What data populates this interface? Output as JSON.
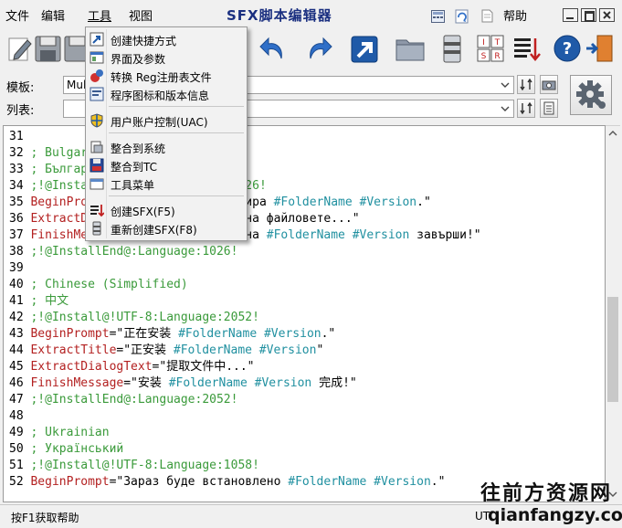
{
  "menubar": {
    "file": "文件",
    "edit": "编辑",
    "tools": "工具",
    "view": "视图",
    "title": "SFX脚本编辑器",
    "help": "帮助"
  },
  "form": {
    "template_label": "模板:",
    "template_value": "Mul",
    "list_label": "列表:",
    "list_value": ""
  },
  "tools_menu": {
    "items": [
      {
        "label": "创建快捷方式",
        "icon": "shortcut-icon"
      },
      {
        "label": "界面及参数",
        "icon": "interface-icon"
      },
      {
        "label": "转换 Reg注册表文件",
        "icon": "registry-icon"
      },
      {
        "label": "程序图标和版本信息",
        "icon": "program-info-icon"
      },
      {
        "label": "用户账户控制(UAC)",
        "icon": "uac-shield-icon"
      },
      {
        "label": "整合到系统",
        "icon": "system-integrate-icon"
      },
      {
        "label": "整合到TC",
        "icon": "tc-disk-icon"
      },
      {
        "label": "工具菜单",
        "icon": "tool-menu-icon"
      },
      {
        "label": "创建SFX(F5)",
        "icon": "create-sfx-icon"
      },
      {
        "label": "重新创建SFX(F8)",
        "icon": "recreate-sfx-icon"
      }
    ]
  },
  "editor": {
    "lines": [
      {
        "n": "31",
        "parts": []
      },
      {
        "n": "32",
        "parts": [
          {
            "t": "; Bulgar",
            "c": "green"
          }
        ]
      },
      {
        "n": "33",
        "parts": [
          {
            "t": "; Българ",
            "c": "green"
          }
        ]
      },
      {
        "n": "34",
        "parts": [
          {
            "t": ";!@Instal",
            "c": "green"
          },
          {
            "t": "                     26!",
            "c": "green"
          }
        ]
      },
      {
        "n": "35",
        "parts": [
          {
            "t": "BeginPrompt",
            "c": "red"
          },
          {
            "t": "                   ира ",
            "c": "black"
          },
          {
            "t": "#FolderName #Version",
            "c": "teal"
          },
          {
            "t": ".\"",
            "c": "black"
          }
        ]
      },
      {
        "n": "36",
        "parts": [
          {
            "t": "ExtractDi",
            "c": "red"
          },
          {
            "t": "                     на файловете...\"",
            "c": "black"
          }
        ]
      },
      {
        "n": "37",
        "parts": [
          {
            "t": "FinishMe",
            "c": "red"
          },
          {
            "t": "                      на ",
            "c": "black"
          },
          {
            "t": "#FolderName #Version",
            "c": "teal"
          },
          {
            "t": " завърши!\"",
            "c": "black"
          }
        ]
      },
      {
        "n": "38",
        "parts": [
          {
            "t": ";!@InstallEnd@:Language:1026!",
            "c": "green"
          }
        ]
      },
      {
        "n": "39",
        "parts": []
      },
      {
        "n": "40",
        "parts": [
          {
            "t": "; Chinese (Simplified)",
            "c": "green"
          }
        ]
      },
      {
        "n": "41",
        "parts": [
          {
            "t": "; 中文",
            "c": "green"
          }
        ]
      },
      {
        "n": "42",
        "parts": [
          {
            "t": ";!@Install@!UTF-8:Language:2052!",
            "c": "green"
          }
        ]
      },
      {
        "n": "43",
        "parts": [
          {
            "t": "BeginPrompt",
            "c": "red"
          },
          {
            "t": "=\"正在安装 ",
            "c": "black"
          },
          {
            "t": "#FolderName #Version",
            "c": "teal"
          },
          {
            "t": ".\"",
            "c": "black"
          }
        ]
      },
      {
        "n": "44",
        "parts": [
          {
            "t": "ExtractTitle",
            "c": "red"
          },
          {
            "t": "=\"正安装 ",
            "c": "black"
          },
          {
            "t": "#FolderName #Version",
            "c": "teal"
          },
          {
            "t": "\"",
            "c": "black"
          }
        ]
      },
      {
        "n": "45",
        "parts": [
          {
            "t": "ExtractDialogText",
            "c": "red"
          },
          {
            "t": "=\"提取文件中...\"",
            "c": "black"
          }
        ]
      },
      {
        "n": "46",
        "parts": [
          {
            "t": "FinishMessage",
            "c": "red"
          },
          {
            "t": "=\"安装 ",
            "c": "black"
          },
          {
            "t": "#FolderName #Version",
            "c": "teal"
          },
          {
            "t": " 完成!\"",
            "c": "black"
          }
        ]
      },
      {
        "n": "47",
        "parts": [
          {
            "t": ";!@InstallEnd@:Language:2052!",
            "c": "green"
          }
        ]
      },
      {
        "n": "48",
        "parts": []
      },
      {
        "n": "49",
        "parts": [
          {
            "t": "; Ukrainian",
            "c": "green"
          }
        ]
      },
      {
        "n": "50",
        "parts": [
          {
            "t": "; Український",
            "c": "green"
          }
        ]
      },
      {
        "n": "51",
        "parts": [
          {
            "t": ";!@Install@!UTF-8:Language:1058!",
            "c": "green"
          }
        ]
      },
      {
        "n": "52",
        "parts": [
          {
            "t": "BeginPrompt",
            "c": "red"
          },
          {
            "t": "=\"Зараз буде встановлено ",
            "c": "black"
          },
          {
            "t": "#FolderName #Version",
            "c": "teal"
          },
          {
            "t": ".\"",
            "c": "black"
          }
        ]
      }
    ]
  },
  "status": {
    "help_text": "按F1获取帮助",
    "encoding": "UT"
  },
  "watermark": {
    "line1": "往前方资源网",
    "line2": "qianfangzy.com"
  }
}
